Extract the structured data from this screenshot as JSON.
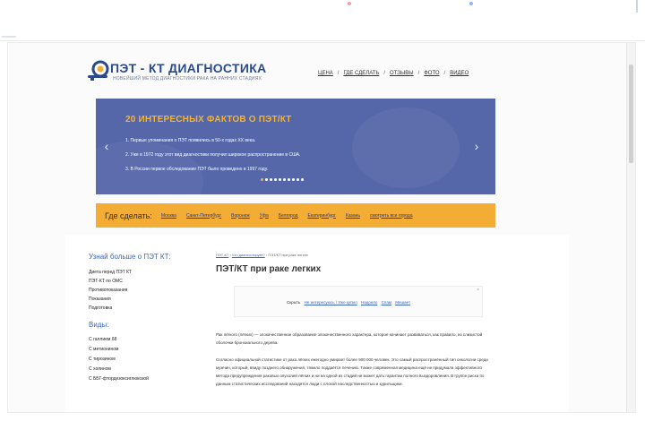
{
  "colors": {
    "brand": "#2b4a8c",
    "slider_bg": "#5667a9",
    "accent_orange": "#f3ad35",
    "slide_title": "#f5b32a",
    "link": "#3d67b5"
  },
  "header": {
    "logo_title": "ПЭТ - КТ ДИАГНОСТИКА",
    "logo_subtitle": "НОВЕЙШИЙ МЕТОД ДИАГНОСТИКИ РАКА НА РАННИХ СТАДИЯХ",
    "nav": [
      "ЦЕНА",
      "ГДЕ СДЕЛАТЬ",
      "ОТЗЫВЫ",
      "ФОТО",
      "ВИДЕО"
    ],
    "nav_separator": "/"
  },
  "slider": {
    "title": "20 ИНТЕРЕСНЫХ ФАКТОВ О ПЭТ/КТ",
    "facts": [
      "1. Первые упоминания о ПЭТ появились в 50-х годах XX века.",
      "2. Уже в 1972 году этот вид диагностики получил широкое распространение в США.",
      "3. В России первое обследование ПЭТ было проведено в 1997 году."
    ],
    "prev_icon": "chevron-left-icon",
    "next_icon": "chevron-right-icon",
    "prev_glyph": "‹",
    "next_glyph": "›",
    "total_dots": 10,
    "active_dot": 1
  },
  "where": {
    "label": "Где сделать:",
    "cities": [
      "Москва",
      "Санкт-Петербург",
      "Воронеж",
      "Уфа",
      "Белгород",
      "Екатеринбург",
      "Казань",
      "смотреть все города"
    ]
  },
  "sidebar": {
    "learn_heading": "Узнай больше о ПЭТ КТ:",
    "learn_items": [
      "Диета перед ПЭТ КТ",
      "ПЭТ-КТ по ОМС",
      "Противопоказания",
      "Показания",
      "Подготовка"
    ],
    "types_heading": "Виды:",
    "type_items": [
      "С галлием 68",
      "С метионином",
      "С тирозином",
      "С холином",
      "С ББГ-фтордезоксиглюкозой"
    ]
  },
  "main": {
    "breadcrumbs": [
      "ПЭТ-КТ",
      "Что диагностирует?",
      "ПЭТ/КТ при раке легких"
    ],
    "crumb_separator": "›",
    "title": "ПЭТ/КТ при раке легких",
    "ad": {
      "close_glyph": "×",
      "hide_label": "Скрыть",
      "options": [
        "Не интересуюсь / Уже купил",
        "Надоело",
        "Спам",
        "Мешает"
      ]
    },
    "paragraphs": [
      "Рак лёгкого (лёгких) — злокачественное образование злокачественного характера, которое начинает развиваться, как правило, из слизистой оболочки бронхиального дерева.",
      "Согласно официальной статистике от рака лёгких ежегодно умирает более 900 000 человек. Это самый распространённый тип онкологии среди мужчин, который, ввиду позднего обнаружения, тяжело поддаётся лечению. Также современная медицина ещё не придумала эффективного метода предупреждения раковых опухолей лёгких и ни на одной из стадий не может дать гарантии полного выздоровления. В группе риска по данным статистических исследований находятся люди с плохой наследственностью и курильщики."
    ]
  }
}
